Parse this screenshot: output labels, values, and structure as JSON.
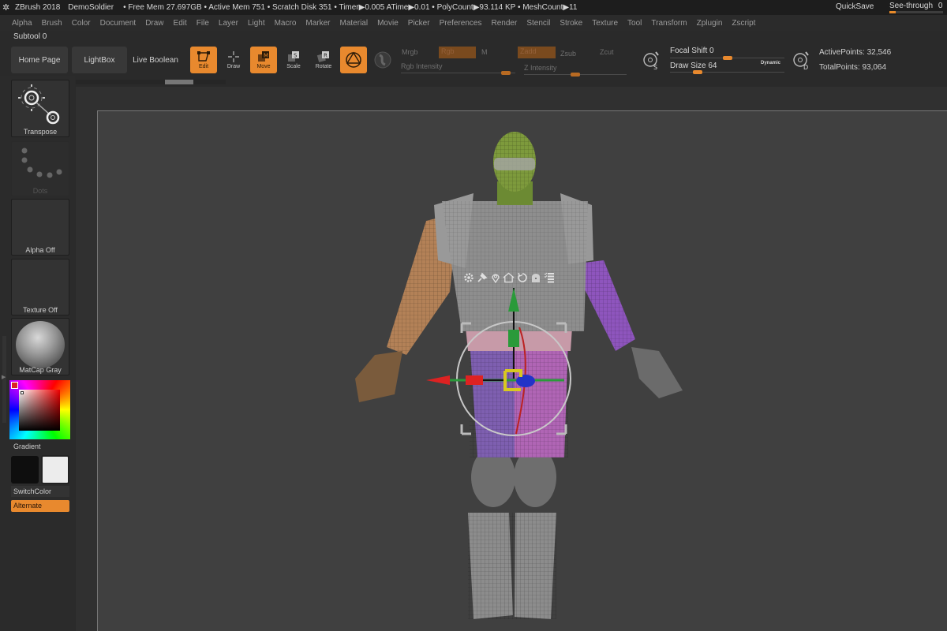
{
  "titlebar": {
    "app_name": "ZBrush 2018",
    "project": "DemoSoldier",
    "stats": "• Free Mem 27.697GB • Active Mem 751 • Scratch Disk 351 •  Timer▶0.005 ATime▶0.01 • PolyCount▶93.114 KP  • MeshCount▶11",
    "quicksave": "QuickSave",
    "see_through_label": "See-through",
    "see_through_value": "0",
    "see_through_fraction": 0.12
  },
  "menu": [
    "Alpha",
    "Brush",
    "Color",
    "Document",
    "Draw",
    "Edit",
    "File",
    "Layer",
    "Light",
    "Macro",
    "Marker",
    "Material",
    "Movie",
    "Picker",
    "Preferences",
    "Render",
    "Stencil",
    "Stroke",
    "Texture",
    "Tool",
    "Transform",
    "Zplugin",
    "Zscript"
  ],
  "subtool_label": "Subtool 0",
  "toolbar": {
    "home_page": "Home Page",
    "lightbox": "LightBox",
    "live_boolean": "Live Boolean",
    "edit": "Edit",
    "draw": "Draw",
    "move": "Move",
    "scale": "Scale",
    "rotate": "Rotate",
    "mrgb": "Mrgb",
    "rgb": "Rgb",
    "m": "M",
    "zadd": "Zadd",
    "zsub": "Zsub",
    "zcut": "Zcut",
    "rgb_intensity": "Rgb Intensity",
    "rgb_intensity_fraction": 0.92,
    "z_intensity": "Z Intensity",
    "z_intensity_fraction": 0.5,
    "focal_shift_label": "Focal Shift",
    "focal_shift_value": "0",
    "focal_shift_fraction": 0.5,
    "draw_size_label": "Draw Size",
    "draw_size_value": "64",
    "draw_size_fraction": 0.24,
    "dynamic": "Dynamic",
    "active_points": "ActivePoints: 32,546",
    "total_points": "TotalPoints: 93,064"
  },
  "leftpanel": {
    "transpose": "Transpose",
    "dots": "Dots",
    "alpha": "Alpha Off",
    "texture": "Texture Off",
    "matcap": "MatCap Gray",
    "gradient": "Gradient",
    "switchcolor": "SwitchColor",
    "alternate": "Alternate",
    "main_color": "#0e0e0e",
    "secondary_color": "#ececec"
  },
  "colors": {
    "accent": "#e8892e",
    "canvas": "#404040",
    "panel": "#2b2b2b"
  },
  "gizmo_menu_icons": [
    "gear-icon",
    "pin-icon",
    "location-icon",
    "home-icon",
    "undo-icon",
    "lock-icon",
    "list-icon"
  ]
}
